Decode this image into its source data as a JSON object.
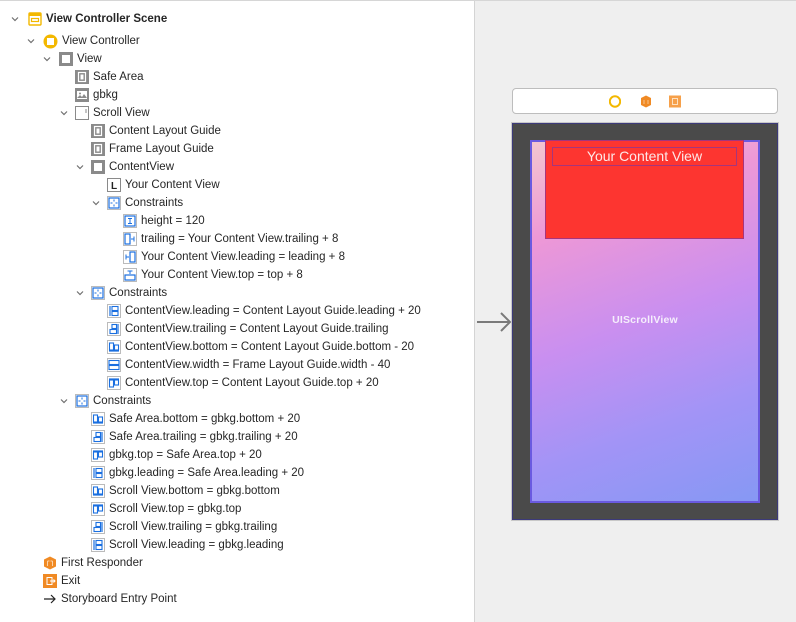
{
  "outline": {
    "scene": {
      "label": "View Controller Scene",
      "icon": "scene-icon"
    },
    "view_controller": {
      "label": "View Controller",
      "icon": "view-controller-icon"
    },
    "view": {
      "label": "View",
      "icon": "view-icon"
    },
    "safe_area": {
      "label": "Safe Area",
      "icon": "layout-guide-icon"
    },
    "gbkg": {
      "label": "gbkg",
      "icon": "image-view-icon"
    },
    "scroll_view": {
      "label": "Scroll View",
      "icon": "scroll-view-icon"
    },
    "content_layout_guide": {
      "label": "Content Layout Guide",
      "icon": "layout-guide-icon"
    },
    "frame_layout_guide": {
      "label": "Frame Layout Guide",
      "icon": "layout-guide-icon"
    },
    "content_view": {
      "label": "ContentView",
      "icon": "view-icon"
    },
    "your_content_view": {
      "label": "Your Content View",
      "icon": "label-icon"
    },
    "content_view_constraints": {
      "label": "Constraints",
      "items": [
        {
          "label": "height = 120",
          "icon": "height-constraint-icon"
        },
        {
          "label": "trailing = Your Content View.trailing + 8",
          "icon": "trailing-constraint-icon"
        },
        {
          "label": "Your Content View.leading = leading + 8",
          "icon": "leading-constraint-icon"
        },
        {
          "label": "Your Content View.top = top + 8",
          "icon": "top-constraint-icon"
        }
      ]
    },
    "scroll_view_constraints": {
      "label": "Constraints",
      "items": [
        {
          "label": "ContentView.leading = Content Layout Guide.leading + 20",
          "icon": "leading-constraint-icon"
        },
        {
          "label": "ContentView.trailing = Content Layout Guide.trailing",
          "icon": "trailing-constraint-icon"
        },
        {
          "label": "ContentView.bottom = Content Layout Guide.bottom - 20",
          "icon": "bottom-constraint-icon"
        },
        {
          "label": "ContentView.width = Frame Layout Guide.width - 40",
          "icon": "width-constraint-icon"
        },
        {
          "label": "ContentView.top = Content Layout Guide.top + 20",
          "icon": "top-constraint-icon"
        }
      ]
    },
    "view_constraints": {
      "label": "Constraints",
      "items": [
        {
          "label": "Safe Area.bottom = gbkg.bottom + 20",
          "icon": "bottom-constraint-icon"
        },
        {
          "label": "Safe Area.trailing = gbkg.trailing + 20",
          "icon": "trailing-constraint-icon"
        },
        {
          "label": "gbkg.top = Safe Area.top + 20",
          "icon": "top-constraint-icon"
        },
        {
          "label": "gbkg.leading = Safe Area.leading + 20",
          "icon": "leading-constraint-icon"
        },
        {
          "label": "Scroll View.bottom = gbkg.bottom",
          "icon": "bottom-constraint-icon"
        },
        {
          "label": "Scroll View.top = gbkg.top",
          "icon": "top-constraint-icon"
        },
        {
          "label": "Scroll View.trailing = gbkg.trailing",
          "icon": "trailing-constraint-icon"
        },
        {
          "label": "Scroll View.leading = gbkg.leading",
          "icon": "leading-constraint-icon"
        }
      ]
    },
    "first_responder": {
      "label": "First Responder",
      "icon": "first-responder-icon"
    },
    "exit": {
      "label": "Exit",
      "icon": "exit-icon"
    },
    "entry_point": {
      "label": "Storyboard Entry Point",
      "icon": "arrow-right-icon"
    }
  },
  "canvas": {
    "scene_dock_icons": [
      "view-controller-icon",
      "first-responder-icon",
      "exit-icon"
    ],
    "content_label": "Your Content View",
    "scroll_view_label": "UIScrollView",
    "colors": {
      "accent_blue": "#1a6fe0",
      "content_red": "#fd3530",
      "device_frame": "#4a4a4a",
      "gradient_start": "#f3c6cf",
      "gradient_end": "#8698f4",
      "vc_yellow": "#f3b800",
      "responder_orange": "#f08a24"
    }
  }
}
